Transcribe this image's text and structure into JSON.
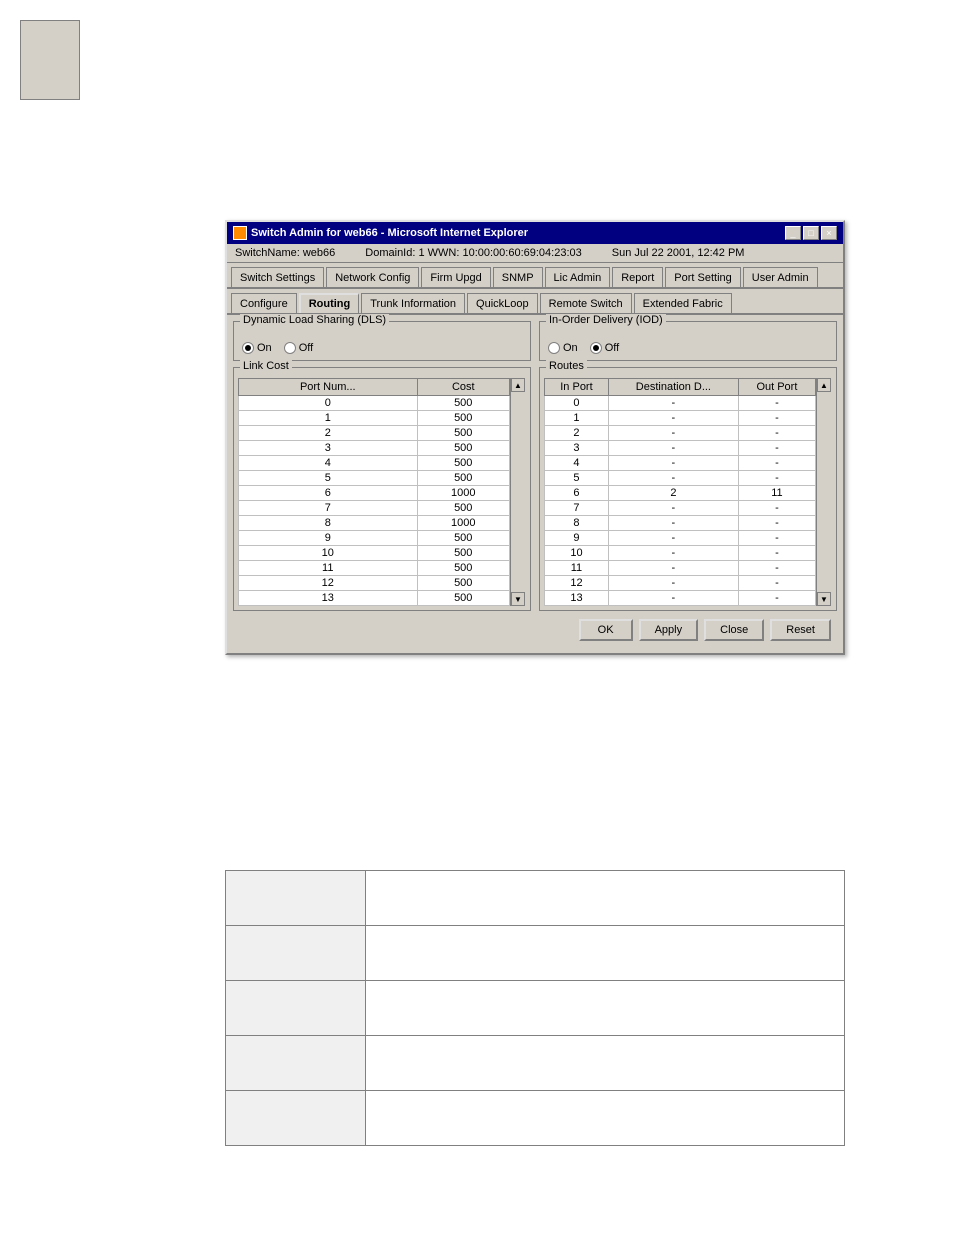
{
  "topLeftBox": {},
  "window": {
    "titleBar": {
      "text": "Switch Admin for web66 - Microsoft Internet Explorer",
      "closeBtn": "×",
      "minBtn": "_",
      "maxBtn": "□"
    },
    "statusBar": {
      "switchName": "SwitchName: web66",
      "domainId": "DomainId: 1  WWN: 10:00:00:60:69:04:23:03",
      "dateTime": "Sun Jul 22  2001, 12:42 PM"
    },
    "tabs1": {
      "items": [
        {
          "label": "Switch Settings"
        },
        {
          "label": "Network Config"
        },
        {
          "label": "Firm Upgd"
        },
        {
          "label": "SNMP"
        },
        {
          "label": "Lic Admin"
        },
        {
          "label": "Report"
        },
        {
          "label": "Port Setting"
        },
        {
          "label": "User Admin"
        }
      ]
    },
    "tabs2": {
      "items": [
        {
          "label": "Configure"
        },
        {
          "label": "Routing",
          "active": true
        },
        {
          "label": "Trunk Information"
        },
        {
          "label": "QuickLoop"
        },
        {
          "label": "Remote Switch"
        },
        {
          "label": "Extended Fabric"
        }
      ]
    },
    "dls": {
      "title": "Dynamic Load Sharing (DLS)",
      "onLabel": "On",
      "offLabel": "Off",
      "onChecked": true,
      "offChecked": false
    },
    "iod": {
      "title": "In-Order Delivery (IOD)",
      "onLabel": "On",
      "offLabel": "Off",
      "onChecked": false,
      "offChecked": true
    },
    "linkCost": {
      "title": "Link Cost",
      "columns": [
        "Port Num...",
        "Cost"
      ],
      "rows": [
        {
          "port": "0",
          "cost": "500"
        },
        {
          "port": "1",
          "cost": "500"
        },
        {
          "port": "2",
          "cost": "500"
        },
        {
          "port": "3",
          "cost": "500"
        },
        {
          "port": "4",
          "cost": "500"
        },
        {
          "port": "5",
          "cost": "500"
        },
        {
          "port": "6",
          "cost": "1000"
        },
        {
          "port": "7",
          "cost": "500"
        },
        {
          "port": "8",
          "cost": "1000"
        },
        {
          "port": "9",
          "cost": "500"
        },
        {
          "port": "10",
          "cost": "500"
        },
        {
          "port": "11",
          "cost": "500"
        },
        {
          "port": "12",
          "cost": "500"
        },
        {
          "port": "13",
          "cost": "500"
        }
      ]
    },
    "routes": {
      "title": "Routes",
      "columns": [
        "In Port",
        "Destination D...",
        "Out Port"
      ],
      "rows": [
        {
          "inPort": "0",
          "dest": "-",
          "outPort": "-"
        },
        {
          "inPort": "1",
          "dest": "-",
          "outPort": "-"
        },
        {
          "inPort": "2",
          "dest": "-",
          "outPort": "-"
        },
        {
          "inPort": "3",
          "dest": "-",
          "outPort": "-"
        },
        {
          "inPort": "4",
          "dest": "-",
          "outPort": "-"
        },
        {
          "inPort": "5",
          "dest": "-",
          "outPort": "-"
        },
        {
          "inPort": "6",
          "dest": "2",
          "outPort": "11"
        },
        {
          "inPort": "7",
          "dest": "-",
          "outPort": "-"
        },
        {
          "inPort": "8",
          "dest": "-",
          "outPort": "-"
        },
        {
          "inPort": "9",
          "dest": "-",
          "outPort": "-"
        },
        {
          "inPort": "10",
          "dest": "-",
          "outPort": "-"
        },
        {
          "inPort": "11",
          "dest": "-",
          "outPort": "-"
        },
        {
          "inPort": "12",
          "dest": "-",
          "outPort": "-"
        },
        {
          "inPort": "13",
          "dest": "-",
          "outPort": "-"
        }
      ]
    },
    "buttons": {
      "ok": "OK",
      "apply": "Apply",
      "close": "Close",
      "reset": "Reset"
    }
  },
  "bottomTable": {
    "rows": [
      {
        "col1": "",
        "col2": ""
      },
      {
        "col1": "",
        "col2": ""
      },
      {
        "col1": "",
        "col2": ""
      },
      {
        "col1": "",
        "col2": ""
      },
      {
        "col1": "",
        "col2": ""
      }
    ]
  }
}
